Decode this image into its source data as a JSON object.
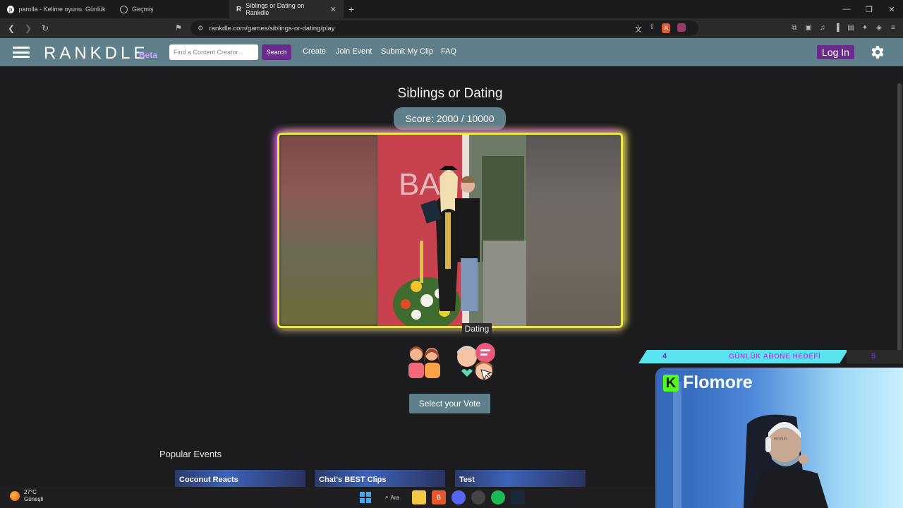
{
  "browser": {
    "tabs": [
      {
        "title": "parolla - Kelime oyunu. Günlük kelim",
        "active": false
      },
      {
        "title": "Geçmiş",
        "active": false
      },
      {
        "title": "Siblings or Dating on Rankdle",
        "active": true
      }
    ],
    "url": "rankdle.com/games/siblings-or-dating/play"
  },
  "header": {
    "logo": "RANKDLE",
    "beta": "Beta",
    "search_placeholder": "Find a Content Creator...",
    "search_button": "Search",
    "nav": [
      "Create",
      "Join Event",
      "Submit My Clip",
      "FAQ"
    ],
    "login": "Log In"
  },
  "game": {
    "title": "Siblings or Dating",
    "score_label": "Score: 2000 / 10000",
    "score": 2000,
    "score_max": 10000,
    "hover_tooltip": "Dating",
    "options": [
      {
        "name": "Siblings",
        "icon": "siblings-icon"
      },
      {
        "name": "Dating",
        "icon": "dating-couple-icon"
      }
    ],
    "select_button": "Select your Vote"
  },
  "popular": {
    "heading": "Popular Events",
    "events": [
      "Coconut Reacts",
      "Chat's BEST Clips",
      "Test"
    ]
  },
  "stream_overlay": {
    "goal_current": "4",
    "goal_text": "GÜNLÜK ABONE HEDEFİ",
    "goal_target": "5",
    "channel": "Flomore"
  },
  "taskbar": {
    "temperature": "27°C",
    "weather": "Güneşli",
    "search": "Ara"
  },
  "colors": {
    "header_bg": "#5f7f8a",
    "accent_purple": "#6a2b8c",
    "page_bg": "#1c1c1e",
    "frame_glow_left": "#cd50e6",
    "frame_glow_right": "#e8e84a"
  }
}
